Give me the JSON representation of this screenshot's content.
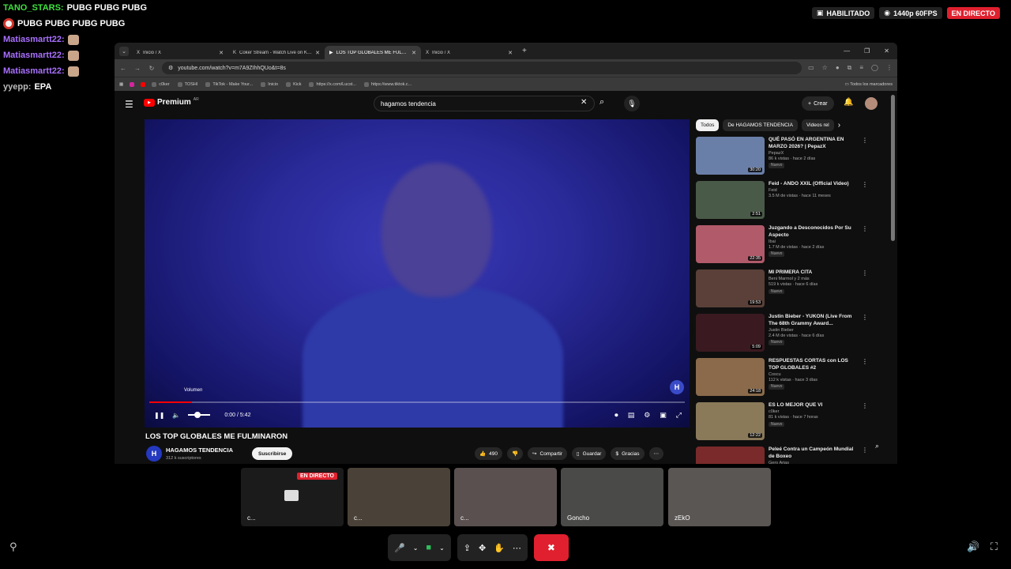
{
  "chat": [
    {
      "user": "TANO_STARS:",
      "text": "PUBG  PUBG  PUBG",
      "color": "green"
    },
    {
      "user": "",
      "text": "PUBG  PUBG  PUBG  PUBG",
      "color": "green"
    },
    {
      "user": "Matiasmartt22:",
      "text": "",
      "color": "purple"
    },
    {
      "user": "Matiasmartt22:",
      "text": "",
      "color": "purple"
    },
    {
      "user": "Matiasmartt22:",
      "text": "",
      "color": "purple"
    },
    {
      "user": "yyepp:",
      "text": "EPA",
      "color": "gray"
    }
  ],
  "stream_badges": {
    "enabled": "HABILITADO",
    "quality": "1440p 60FPS",
    "live": "EN DIRECTO"
  },
  "browser": {
    "tabs": [
      {
        "label": "Inicio / X",
        "icon": "x-icon",
        "active": false
      },
      {
        "label": "Coker Stream - Watch Live on Kick",
        "icon": "kick-icon",
        "active": false
      },
      {
        "label": "LOS TOP GLOBALES ME FULMINARON",
        "icon": "youtube-icon",
        "active": true
      },
      {
        "label": "Inicio / X",
        "icon": "x-icon",
        "active": false
      }
    ],
    "url": "youtube.com/watch?v=m7A9ZIhhQUo&t=8s",
    "bookmarks": [
      "c0ker",
      "TOSHI",
      "TikTok - Make Your...",
      "Inicio",
      "Kick",
      "https://x.com/Lucst...",
      "https://www.tiktok.c..."
    ],
    "bookmarks_all": "Todos los marcadores"
  },
  "youtube": {
    "logo": "Premium",
    "logo_sup": "AR",
    "search": "hagamos tendencia",
    "create": "Crear",
    "player": {
      "volume_tooltip": "Volumen",
      "time": "0:00 / 5:42",
      "progress": 0.08,
      "volume": 0.4
    },
    "title": "LOS TOP GLOBALES ME FULMINARON",
    "channel": "HAGAMOS TENDENCIA",
    "subs": "312 k suscriptores",
    "subscribe": "Suscribirse",
    "likes": "490",
    "share": "Compartir",
    "save": "Guardar",
    "thanks": "Gracias",
    "chips": [
      "Todos",
      "De HAGAMOS TENDENCIA",
      "Videos rel"
    ],
    "recommendations": [
      {
        "title": "QUÉ PASÓ EN ARGENTINA EN MARZO 2026? | PepazX",
        "channel": "PepazX",
        "meta": "86 k vistas · hace 2 días",
        "duration": "30:20",
        "new": "Nuevo",
        "color": "#6a7fa8"
      },
      {
        "title": "Feid - ANDO XXIL (Official Video)",
        "channel": "Feid",
        "meta": "3.5 M de vistas · hace 11 meses",
        "duration": "2:51",
        "new": "",
        "color": "#4a5a48"
      },
      {
        "title": "Juzgando a Desconocidos Por Su Aspecto",
        "channel": "Ibai",
        "meta": "1.7 M de vistas · hace 2 días",
        "duration": "22:35",
        "new": "Nuevo",
        "color": "#b05a6a"
      },
      {
        "title": "MI PRIMERA CITA",
        "channel": "Beni Marmol y 2 más",
        "meta": "519 k vistas · hace 6 días",
        "duration": "19:53",
        "new": "Nuevo",
        "color": "#5a4038"
      },
      {
        "title": "Justin Bieber - YUKON (Live From The 68th Grammy Award...",
        "channel": "Justin Bieber",
        "meta": "2.4 M de vistas · hace 6 días",
        "duration": "5:09",
        "new": "Nuevo",
        "color": "#3a1a20"
      },
      {
        "title": "RESPUESTAS CORTAS con LOS TOP GLOBALES #2",
        "channel": "Coscu",
        "meta": "112 k vistas · hace 3 días",
        "duration": "24:18",
        "new": "Nuevo",
        "color": "#8a6a4a"
      },
      {
        "title": "ES LO MEJOR QUE VI",
        "channel": "c0ker",
        "meta": "81 k vistas · hace 7 horas",
        "duration": "12:22",
        "new": "Nuevo",
        "color": "#8a7a5a"
      },
      {
        "title": "Peleé Contra un Campeón Mundial de Boxeo",
        "channel": "Gero Arias",
        "meta": "",
        "duration": "",
        "new": "",
        "color": "#7a2a2a"
      }
    ]
  },
  "tiles": [
    {
      "name": "c...",
      "live": "EN DIRECTO",
      "color": "#1b1b1b"
    },
    {
      "name": "c...",
      "live": "",
      "color": "#4a4238"
    },
    {
      "name": "c...",
      "live": "",
      "color": "#5a5050"
    },
    {
      "name": "Goncho",
      "live": "",
      "color": "#4a4a48"
    },
    {
      "name": "zEkO",
      "live": "",
      "color": "#5a5654"
    }
  ],
  "colors": {
    "accent": "#e0202e",
    "yt_red": "#ff0000",
    "bg": "#000000"
  }
}
